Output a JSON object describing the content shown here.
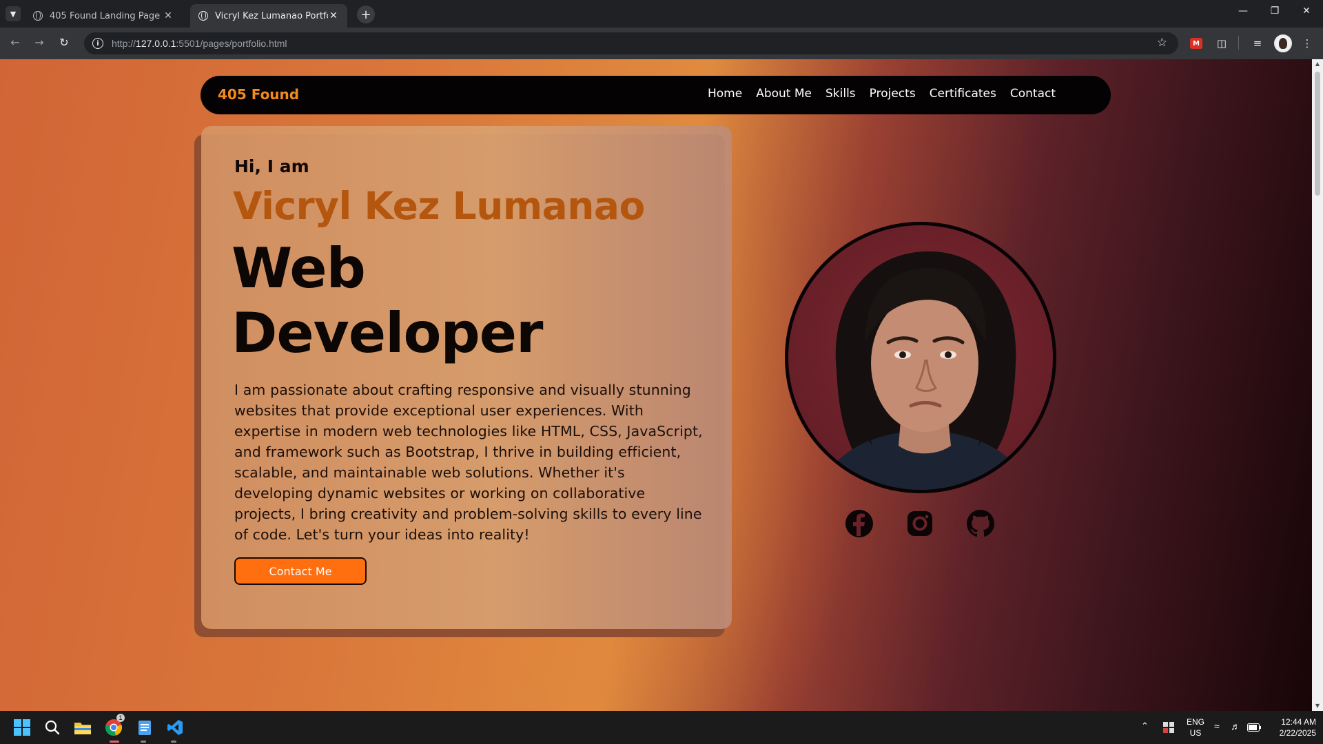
{
  "browser": {
    "tabs": [
      {
        "title": "405 Found Landing Page",
        "active": false
      },
      {
        "title": "Vicryl Kez Lumanao Portfolio",
        "active": true
      }
    ],
    "url_prefix": "http://",
    "url_host": "127.0.0.1",
    "url_rest": ":5501/pages/portfolio.html"
  },
  "site": {
    "brand": "405 Found",
    "nav": [
      "Home",
      "About Me",
      "Skills",
      "Projects",
      "Certificates",
      "Contact"
    ],
    "hero": {
      "greeting": "Hi, I am",
      "name": "Vicryl Kez Lumanao",
      "role_line1": "Web",
      "role_line2": "Developer",
      "bio": "I am passionate about crafting responsive and visually stunning websites that provide exceptional user experiences. With expertise in modern web technologies like HTML, CSS, JavaScript, and framework such as Bootstrap, I thrive in building efficient, scalable, and maintainable web solutions. Whether it's developing dynamic websites or working on collaborative projects, I bring creativity and problem-solving skills to every line of code. Let's turn your ideas into reality!",
      "cta": "Contact Me"
    },
    "socials": [
      "facebook-icon",
      "instagram-icon",
      "github-icon"
    ],
    "colors": {
      "brand": "#f28a1c",
      "name": "#b4560e",
      "cta": "#ff6f0f"
    }
  },
  "taskbar": {
    "lang_line1": "ENG",
    "lang_line2": "US",
    "time": "12:44 AM",
    "date": "2/22/2025",
    "chrome_badge": "1"
  }
}
